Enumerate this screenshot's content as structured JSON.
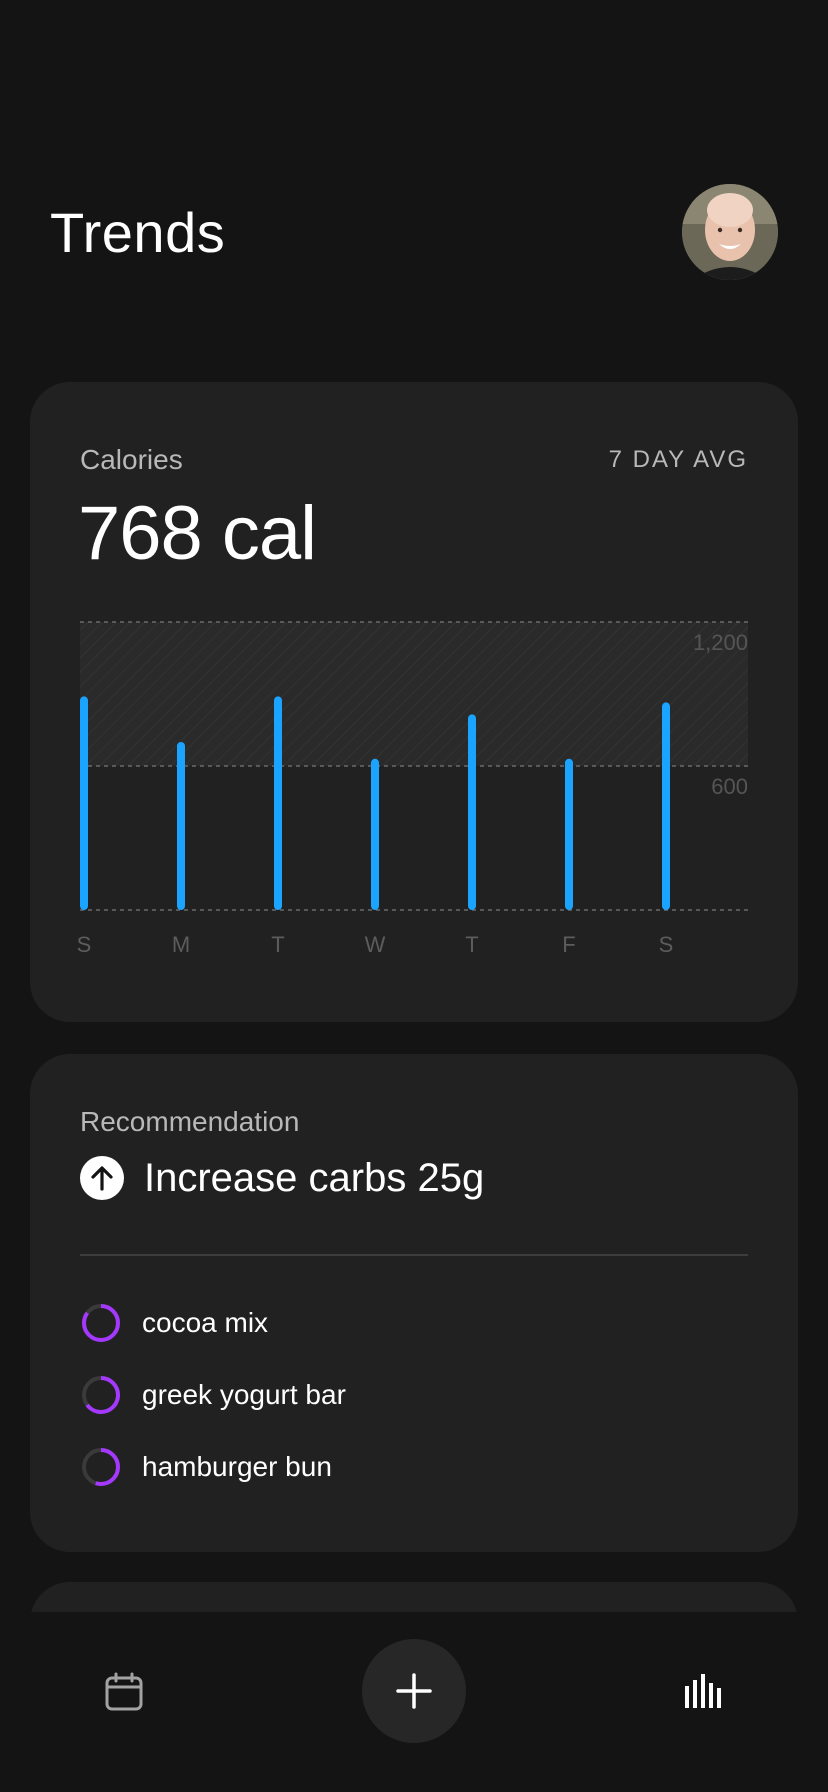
{
  "header": {
    "title": "Trends"
  },
  "calories_card": {
    "label": "Calories",
    "period": "7 DAY AVG",
    "value": "768 cal"
  },
  "chart_data": {
    "type": "bar",
    "categories": [
      "S",
      "M",
      "T",
      "W",
      "T",
      "F",
      "S"
    ],
    "values": [
      890,
      700,
      890,
      630,
      815,
      630,
      865
    ],
    "y_ticks": [
      600,
      1200
    ],
    "y_tick_labels": [
      "600",
      "1,200"
    ],
    "ylim": [
      0,
      1200
    ],
    "grid": true,
    "colors": {
      "bar": "#1aa3ff",
      "grid": "#6a6a6a",
      "band": "#2a2a2a"
    }
  },
  "recommendation_card": {
    "label": "Recommendation",
    "title": "Increase carbs 25g",
    "items": [
      {
        "name": "cocoa mix",
        "progress": 0.85
      },
      {
        "name": "greek yogurt bar",
        "progress": 0.65
      },
      {
        "name": "hamburger bun",
        "progress": 0.55
      }
    ],
    "ring_color": "#a438ff",
    "ring_track_color": "#3a3a3a"
  },
  "nav": {
    "items": [
      {
        "icon": "calendar-icon"
      },
      {
        "icon": "plus-icon"
      },
      {
        "icon": "trends-bars-icon"
      }
    ]
  }
}
